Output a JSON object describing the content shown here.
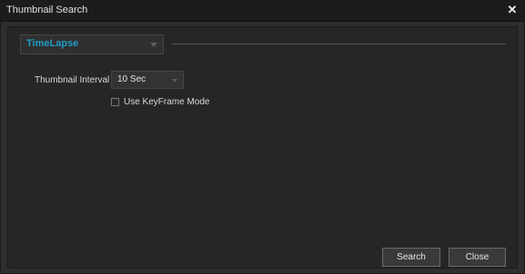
{
  "window": {
    "title": "Thumbnail Search",
    "close_glyph": "✕"
  },
  "mode": {
    "selected": "TimeLapse",
    "accent_color": "#1f9cc6"
  },
  "interval": {
    "label": "Thumbnail Interval",
    "selected": "10 Sec"
  },
  "keyframe": {
    "label": "Use KeyFrame Mode",
    "checked": false
  },
  "buttons": {
    "search": "Search",
    "close": "Close"
  }
}
